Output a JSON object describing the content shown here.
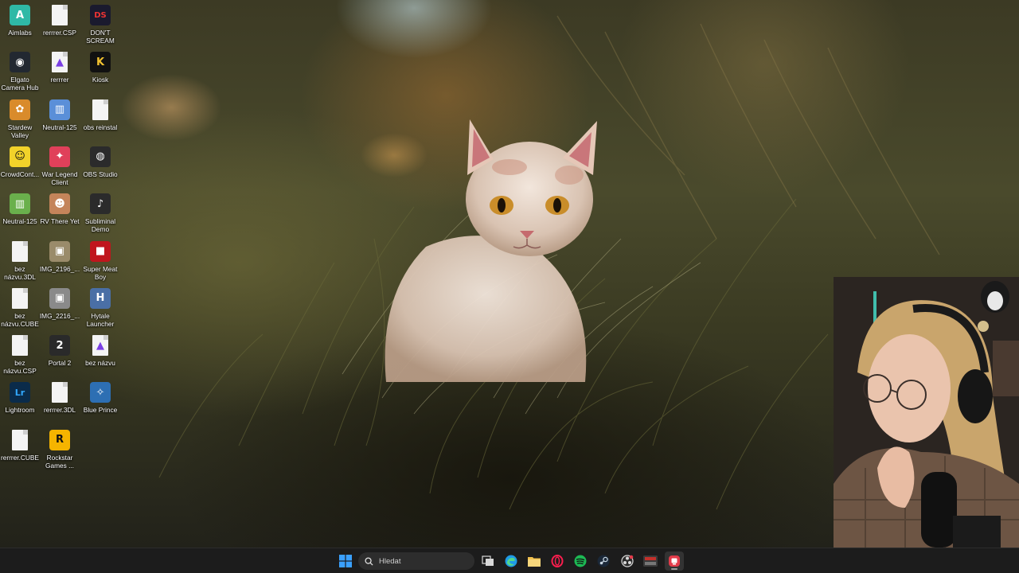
{
  "desktop": {
    "icons": [
      {
        "label": "Aimlabs",
        "icon": "aimlabs-icon",
        "color": "#2fb9a6",
        "glyph": "A"
      },
      {
        "label": "rerrrer.CSP",
        "icon": "file-icon",
        "color": "#f4f4f4",
        "glyph": ""
      },
      {
        "label": "DON'T SCREAM",
        "icon": "dont-scream-icon",
        "color": "#1a1a2e",
        "glyph": "DS"
      },
      {
        "label": "Elgato Camera Hub",
        "icon": "elgato-camera-icon",
        "color": "#222831",
        "glyph": "◉"
      },
      {
        "label": "rerrrer",
        "icon": "affinity-file-icon",
        "color": "#f4f4f4",
        "glyph": "▲"
      },
      {
        "label": "Kiosk",
        "icon": "kiosk-icon",
        "color": "#111111",
        "glyph": "K"
      },
      {
        "label": "Stardew Valley",
        "icon": "stardew-valley-icon",
        "color": "#d98b2b",
        "glyph": "✿"
      },
      {
        "label": "Neutral-125",
        "icon": "neutral-palette-icon",
        "color": "#5a8fd8",
        "glyph": "▥"
      },
      {
        "label": "obs reinstal",
        "icon": "json-file-icon",
        "color": "#f4f4f4",
        "glyph": ""
      },
      {
        "label": "CrowdCont...",
        "icon": "crowdcontrol-icon",
        "color": "#f2d22a",
        "glyph": "☺"
      },
      {
        "label": "War Legend Client",
        "icon": "war-legend-icon",
        "color": "#e0405a",
        "glyph": "✦"
      },
      {
        "label": "OBS Studio",
        "icon": "obs-studio-icon",
        "color": "#2b2b2b",
        "glyph": "◍"
      },
      {
        "label": "Neutral-125",
        "icon": "neutral-palette-icon",
        "color": "#6ab04c",
        "glyph": "▥"
      },
      {
        "label": "RV There Yet",
        "icon": "rv-there-yet-icon",
        "color": "#c4845a",
        "glyph": "☻"
      },
      {
        "label": "Subliminal Demo",
        "icon": "subliminal-icon",
        "color": "#2b2b2b",
        "glyph": "♪"
      },
      {
        "label": "bez názvu.3DL",
        "icon": "file-icon",
        "color": "#f4f4f4",
        "glyph": ""
      },
      {
        "label": "IMG_2196_...",
        "icon": "image-file-icon",
        "color": "#9a8b6a",
        "glyph": "▣"
      },
      {
        "label": "Super Meat Boy",
        "icon": "super-meat-boy-icon",
        "color": "#c0161d",
        "glyph": "■"
      },
      {
        "label": "bez názvu.CUBE",
        "icon": "file-icon",
        "color": "#f4f4f4",
        "glyph": ""
      },
      {
        "label": "IMG_2216_...",
        "icon": "image-file-icon",
        "color": "#8a8a8a",
        "glyph": "▣"
      },
      {
        "label": "Hytale Launcher",
        "icon": "hytale-icon",
        "color": "#4a6fa5",
        "glyph": "H"
      },
      {
        "label": "bez názvu.CSP",
        "icon": "file-icon",
        "color": "#f4f4f4",
        "glyph": ""
      },
      {
        "label": "Portal 2",
        "icon": "portal-2-icon",
        "color": "#2a2a2a",
        "glyph": "2"
      },
      {
        "label": "bez názvu",
        "icon": "affinity-file-icon",
        "color": "#f4f4f4",
        "glyph": "▲"
      },
      {
        "label": "Lightroom",
        "icon": "lightroom-icon",
        "color": "#0a2b4a",
        "glyph": "Lr"
      },
      {
        "label": "rerrrer.3DL",
        "icon": "file-icon",
        "color": "#f4f4f4",
        "glyph": ""
      },
      {
        "label": "Blue Prince",
        "icon": "blue-prince-icon",
        "color": "#2d6fb3",
        "glyph": "✧"
      },
      {
        "label": "rerrrer.CUBE",
        "icon": "file-icon",
        "color": "#f4f4f4",
        "glyph": ""
      },
      {
        "label": "Rockstar Games ...",
        "icon": "rockstar-games-icon",
        "color": "#f5b400",
        "glyph": "R"
      }
    ]
  },
  "taskbar": {
    "search_placeholder": "Hledat",
    "apps": [
      {
        "name": "start-button",
        "icon": "windows-logo-icon",
        "color": "#3aa0ff"
      },
      {
        "name": "task-view-button",
        "icon": "task-view-icon",
        "color": "#d8d8d8"
      },
      {
        "name": "edge-button",
        "icon": "edge-icon",
        "color": "#1f9be6"
      },
      {
        "name": "file-explorer-button",
        "icon": "folder-icon",
        "color": "#f2c14e"
      },
      {
        "name": "opera-gx-button",
        "icon": "opera-gx-icon",
        "color": "#fa1e4e"
      },
      {
        "name": "spotify-button",
        "icon": "spotify-icon",
        "color": "#1db954"
      },
      {
        "name": "steam-button",
        "icon": "steam-icon",
        "color": "#c7d5e0"
      },
      {
        "name": "obs-button",
        "icon": "obs-icon",
        "color": "#d8d8d8"
      },
      {
        "name": "streamer-app-button",
        "icon": "stream-deck-icon",
        "color": "#c4302b"
      },
      {
        "name": "active-app-button",
        "icon": "app-icon",
        "color": "#e23b4a"
      }
    ]
  },
  "webcam": {
    "label": "webcam-overlay"
  }
}
